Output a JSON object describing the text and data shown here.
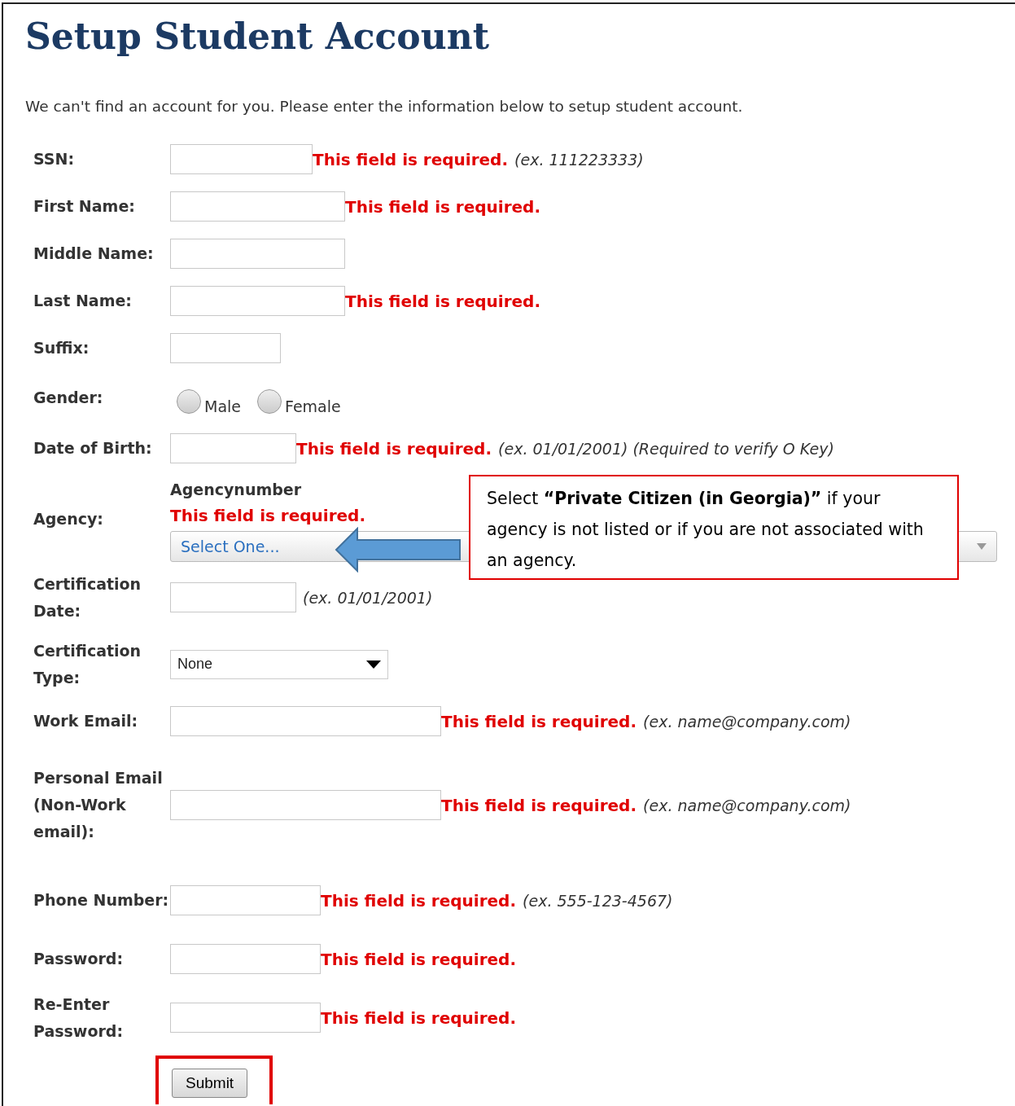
{
  "title": "Setup Student Account",
  "intro": "We can't find an account for you. Please enter the information below to setup student account.",
  "fields": [
    {
      "kind": "text",
      "label": "SSN:",
      "error": "This field is required.",
      "example": "(ex. 111223333)"
    },
    {
      "kind": "text",
      "label": "First Name:",
      "error": "This field is required."
    },
    {
      "kind": "text",
      "label": "Middle Name:"
    },
    {
      "kind": "text",
      "label": "Last Name:",
      "error": "This field is required."
    },
    {
      "kind": "text",
      "label": "Suffix:"
    },
    {
      "kind": "radio",
      "label": "Gender:",
      "options": [
        {
          "label": "Male",
          "selected": false
        },
        {
          "label": "Female",
          "selected": false
        }
      ]
    },
    {
      "kind": "text",
      "label": "Date of Birth:",
      "error": "This field is required.",
      "example": "(ex. 01/01/2001) (Required to verify O Key)"
    },
    {
      "kind": "agency",
      "label": "Agency:",
      "sublabel": "Agencynumber",
      "error": "This field is required.",
      "value": "Select One..."
    },
    {
      "kind": "text",
      "label": "Certification Date:",
      "example": "(ex. 01/01/2001)"
    },
    {
      "kind": "select",
      "label": "Certification Type:",
      "value": "None"
    },
    {
      "kind": "text",
      "label": "Work Email:",
      "error": "This field is required.",
      "example": "(ex. name@company.com)"
    },
    {
      "kind": "text",
      "label": "Personal Email (Non-Work email):",
      "error": "This field is required.",
      "example": "(ex. name@company.com)"
    },
    {
      "kind": "text",
      "label": "Phone Number:",
      "error": "This field is required.",
      "example": "(ex. 555-123-4567)"
    },
    {
      "kind": "text",
      "label": "Password:",
      "error": "This field is required."
    },
    {
      "kind": "text",
      "label": "Re-Enter Password:",
      "error": "This field is required."
    }
  ],
  "callout": "Select **“Private Citizen (in Georgia)”** if your agency is not listed or if you are not associated with an agency.",
  "submit": "Submit"
}
